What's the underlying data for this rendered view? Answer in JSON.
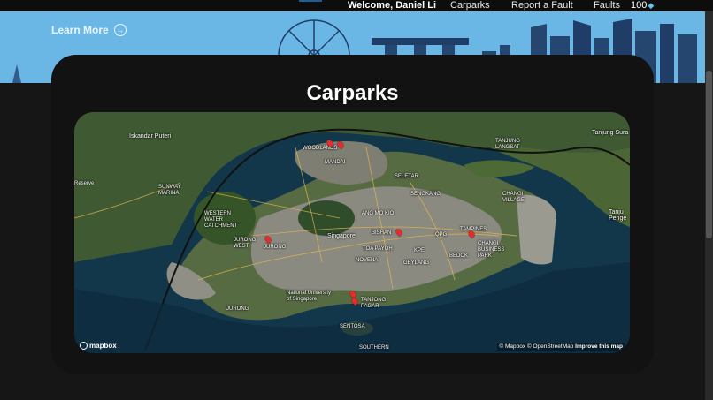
{
  "nav": {
    "welcome": "Welcome, Daniel Li",
    "links": [
      "Carparks",
      "Report a Fault",
      "Faults"
    ],
    "points": "100",
    "points_icon": "diamond-icon"
  },
  "hero": {
    "learn_more": "Learn More"
  },
  "page": {
    "title": "Carparks"
  },
  "map": {
    "labels": {
      "iskandar": "Iskandar Puteri",
      "woodlands": "WOODLANDS",
      "mandai": "MANDAI",
      "tanjung_langsat": "TANJUNG\nLANGSAT",
      "tanjung_surat": "Tanjung Sura",
      "sunway": "SUNWAY\nMARINA",
      "seletar": "SELETAR",
      "sengkang": "SENGKANG",
      "changi_village": "CHANGI\nVILLAGE",
      "ang_mo_kio": "ANG MO KIO",
      "western_water": "WESTERN\nWATER\nCATCHMENT",
      "singapore": "Singapore",
      "bishan": "BISHAN",
      "qpg": "QPG",
      "tampines": "TAMPINES",
      "jurong_west": "JURONG\nWEST",
      "jurong": "JURONG",
      "toa_payoh": "TOA PAYOH",
      "kpe": "KPE",
      "novena": "NOVENA",
      "geylang": "GEYLANG",
      "bedok": "BEDOK",
      "changi_business": "CHANGI\nBUSINESS\nPARK",
      "nus": "National University\nof Singapore",
      "jurong_island": "JURONG",
      "tanjong_pagar": "TANJONG\nPAGAR",
      "sentosa": "SENTOSA",
      "southern": "SOUTHERN",
      "tanjung_pengel": "Tanju\nPenge",
      "serve": "Reserve"
    },
    "logo": "mapbox",
    "attribution": "© Mapbox © OpenStreetMap",
    "attribution_link": "Improve this map",
    "marker_icon": "map-pin-icon",
    "marker_count": 7
  }
}
